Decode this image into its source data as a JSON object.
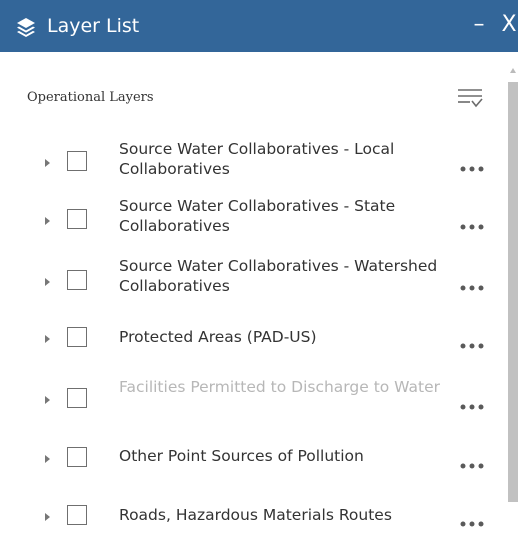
{
  "window": {
    "title": "Layer List",
    "minimize_label": "–",
    "close_label": "X"
  },
  "header": {
    "section_title": "Operational Layers"
  },
  "colors": {
    "titlebar": "#336699",
    "text": "#333333",
    "disabled_text": "#b7b7b7"
  },
  "icons": {
    "title": "layers-icon",
    "filter": "filter-list-icon",
    "expand": "caret-right-icon",
    "more": "ellipsis-icon"
  },
  "layers": [
    {
      "label": "Source Water Collaboratives - Local Collaboratives",
      "checked": false,
      "enabled": true
    },
    {
      "label": "Source Water Collaboratives - State Collaboratives",
      "checked": false,
      "enabled": true
    },
    {
      "label": "Source Water Collaboratives - Watershed Collaboratives",
      "checked": false,
      "enabled": true
    },
    {
      "label": "Protected Areas (PAD-US)",
      "checked": false,
      "enabled": true
    },
    {
      "label": "Facilities Permitted to Discharge to Water",
      "checked": false,
      "enabled": false
    },
    {
      "label": "Other Point Sources of Pollution",
      "checked": false,
      "enabled": true
    },
    {
      "label": "Roads, Hazardous Materials Routes",
      "checked": false,
      "enabled": true
    }
  ]
}
